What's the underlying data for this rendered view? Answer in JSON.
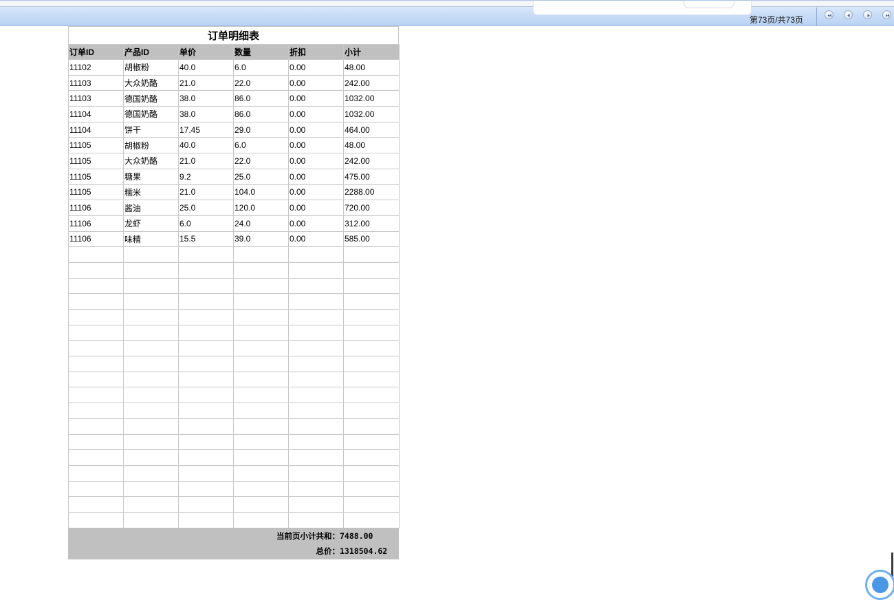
{
  "toolbar": {
    "page_info": "第73页/共73页",
    "nav": [
      "first-page",
      "prev-page",
      "next-page",
      "last-page"
    ]
  },
  "report": {
    "title": "订单明细表",
    "columns": [
      "订单ID",
      "产品ID",
      "单价",
      "数量",
      "折扣",
      "小计"
    ],
    "rows": [
      [
        "11102",
        "胡椒粉",
        "40.0",
        "6.0",
        "0.00",
        "48.00"
      ],
      [
        "11103",
        "大众奶酪",
        "21.0",
        "22.0",
        "0.00",
        "242.00"
      ],
      [
        "11103",
        "德国奶酪",
        "38.0",
        "86.0",
        "0.00",
        "1032.00"
      ],
      [
        "11104",
        "德国奶酪",
        "38.0",
        "86.0",
        "0.00",
        "1032.00"
      ],
      [
        "11104",
        "饼干",
        "17.45",
        "29.0",
        "0.00",
        "464.00"
      ],
      [
        "11105",
        "胡椒粉",
        "40.0",
        "6.0",
        "0.00",
        "48.00"
      ],
      [
        "11105",
        "大众奶酪",
        "21.0",
        "22.0",
        "0.00",
        "242.00"
      ],
      [
        "11105",
        "糖果",
        "9.2",
        "25.0",
        "0.00",
        "475.00"
      ],
      [
        "11105",
        "糯米",
        "21.0",
        "104.0",
        "0.00",
        "2288.00"
      ],
      [
        "11106",
        "酱油",
        "25.0",
        "120.0",
        "0.00",
        "720.00"
      ],
      [
        "11106",
        "龙虾",
        "6.0",
        "24.0",
        "0.00",
        "312.00"
      ],
      [
        "11106",
        "味精",
        "15.5",
        "39.0",
        "0.00",
        "585.00"
      ]
    ],
    "page_subtotal_label": "当前页小计共和：",
    "page_subtotal_value": "7488.00",
    "total_label": "总价：",
    "total_value": "1318504.62"
  }
}
